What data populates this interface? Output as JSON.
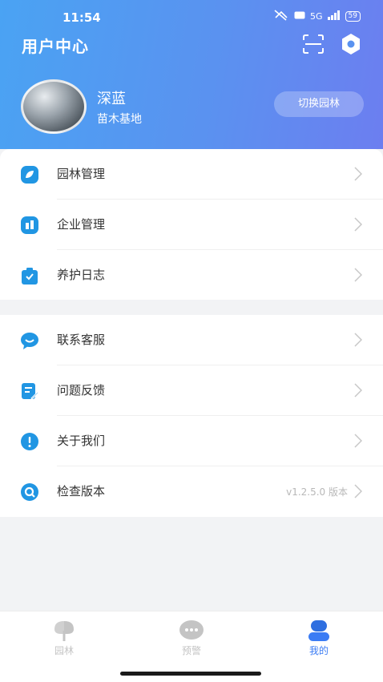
{
  "status_bar": {
    "time": "11:54",
    "network": "5G",
    "battery": "59"
  },
  "header": {
    "title": "用户中心"
  },
  "user": {
    "name": "深蓝",
    "org": "苗木基地",
    "switch_label": "切换园林"
  },
  "menu_group_1": [
    {
      "label": "园林管理",
      "icon": "leaf-icon"
    },
    {
      "label": "企业管理",
      "icon": "building-icon"
    },
    {
      "label": "养护日志",
      "icon": "log-icon"
    }
  ],
  "menu_group_2": [
    {
      "label": "联系客服",
      "icon": "chat-icon"
    },
    {
      "label": "问题反馈",
      "icon": "edit-icon"
    },
    {
      "label": "关于我们",
      "icon": "info-icon"
    },
    {
      "label": "检查版本",
      "icon": "search-icon",
      "extra": "v1.2.5.0 版本"
    }
  ],
  "tabs": [
    {
      "label": "园林",
      "icon": "tree-icon",
      "active": false
    },
    {
      "label": "预警",
      "icon": "alert-bubble-icon",
      "active": false
    },
    {
      "label": "我的",
      "icon": "user-icon",
      "active": true
    }
  ],
  "colors": {
    "accent": "#3b7cf4",
    "header_start": "#4aa3f3",
    "header_end": "#6c7ef0",
    "icon_blue": "#2196e3"
  }
}
